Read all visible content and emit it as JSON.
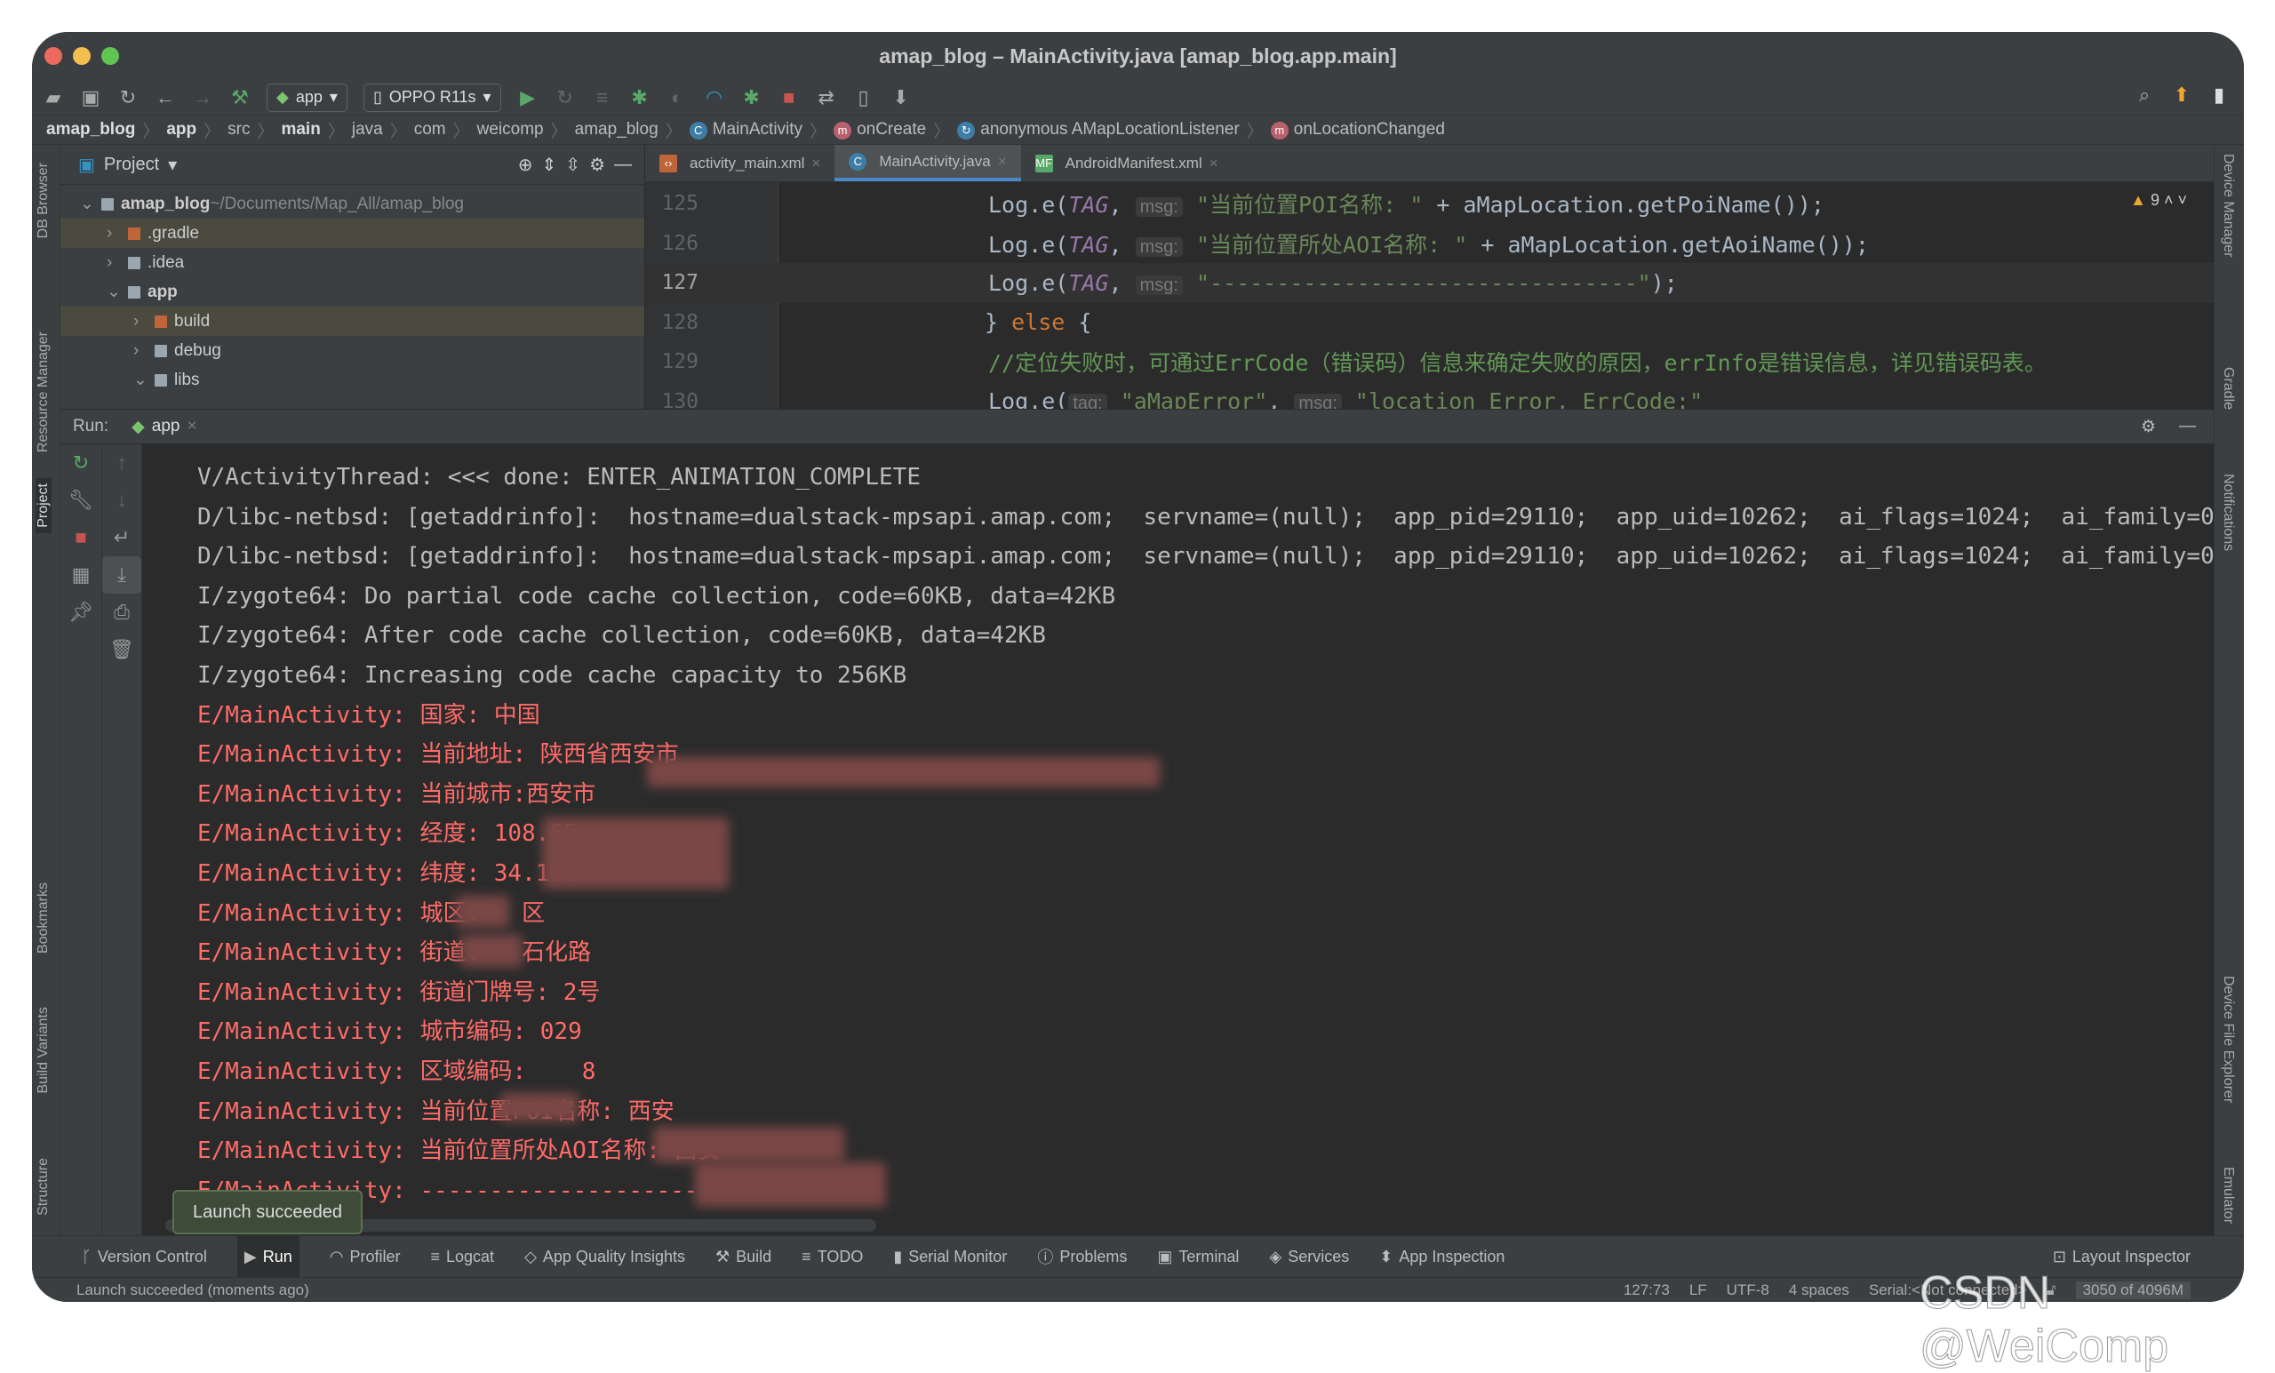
{
  "window": {
    "title": "amap_blog – MainActivity.java [amap_blog.app.main]"
  },
  "toolbar": {
    "config": "app",
    "device": "OPPO R11s"
  },
  "breadcrumb": [
    "amap_blog",
    "app",
    "src",
    "main",
    "java",
    "com",
    "weicomp",
    "amap_blog",
    "MainActivity",
    "onCreate",
    "anonymous AMapLocationListener",
    "onLocationChanged"
  ],
  "left_stripe": [
    "DB Browser",
    "Resource Manager",
    "Project",
    "Bookmarks",
    "Build Variants",
    "Structure"
  ],
  "right_stripe": [
    "Device Manager",
    "Gradle",
    "Notifications",
    "Device File Explorer",
    "Emulator"
  ],
  "project": {
    "title": "Project",
    "tree": [
      {
        "name": "amap_blog",
        "path": "~/Documents/Map_All/amap_blog",
        "depth": 0,
        "open": true,
        "bold": true
      },
      {
        "name": ".gradle",
        "depth": 1,
        "open": false,
        "excluded": true
      },
      {
        "name": ".idea",
        "depth": 1,
        "open": false
      },
      {
        "name": "app",
        "depth": 1,
        "open": true,
        "bold": true
      },
      {
        "name": "build",
        "depth": 2,
        "open": false,
        "excluded": true
      },
      {
        "name": "debug",
        "depth": 2,
        "open": false
      },
      {
        "name": "libs",
        "depth": 2,
        "open": true
      }
    ]
  },
  "editor": {
    "tabs": [
      {
        "label": "activity_main.xml",
        "active": false
      },
      {
        "label": "MainActivity.java",
        "active": true
      },
      {
        "label": "AndroidManifest.xml",
        "active": false
      }
    ],
    "warnings": "9",
    "lines": [
      {
        "n": "125",
        "segs": [
          [
            "t",
            "Log.e("
          ],
          [
            "p",
            "TAG"
          ],
          [
            "t",
            ", "
          ],
          [
            "h",
            "msg:"
          ],
          [
            "s",
            " \"当前位置POI名称: \""
          ],
          [
            "t",
            " + aMapLocation.getPoiName());"
          ]
        ]
      },
      {
        "n": "126",
        "segs": [
          [
            "t",
            "Log.e("
          ],
          [
            "p",
            "TAG"
          ],
          [
            "t",
            ", "
          ],
          [
            "h",
            "msg:"
          ],
          [
            "s",
            " \"当前位置所处AOI名称: \""
          ],
          [
            "t",
            " + aMapLocation.getAoiName());"
          ]
        ]
      },
      {
        "n": "127",
        "cur": true,
        "segs": [
          [
            "t",
            "Log.e("
          ],
          [
            "p",
            "TAG"
          ],
          [
            "t",
            ", "
          ],
          [
            "h",
            "msg:"
          ],
          [
            "s",
            " \"--------------------------------\""
          ],
          [
            "t",
            ");"
          ]
        ]
      },
      {
        "n": "128",
        "indent": -1,
        "segs": [
          [
            "t",
            "} "
          ],
          [
            "k",
            "else"
          ],
          [
            "t",
            " {"
          ]
        ]
      },
      {
        "n": "129",
        "segs": [
          [
            "c",
            "//定位失败时，可通过ErrCode（错误码）信息来确定失败的原因，errInfo是错误信息，详见错误码表。"
          ]
        ]
      },
      {
        "n": "130",
        "segs": [
          [
            "t",
            "Log.e("
          ],
          [
            "h",
            "tag:"
          ],
          [
            "s",
            " \"aMapError\""
          ],
          [
            "t",
            ", "
          ],
          [
            "h",
            "msg:"
          ],
          [
            "s",
            " \"location Error, ErrCode:\""
          ]
        ]
      }
    ]
  },
  "run": {
    "label": "Run:",
    "tab": "app",
    "log": [
      {
        "lv": "v",
        "text": "V/ActivityThread: <<< done: ENTER_ANIMATION_COMPLETE"
      },
      {
        "lv": "d",
        "text": "D/libc-netbsd: [getaddrinfo]:  hostname=dualstack-mpsapi.amap.com;  servname=(null);  app_pid=29110;  app_uid=10262;  ai_flags=1024;  ai_family=0;"
      },
      {
        "lv": "d",
        "text": "D/libc-netbsd: [getaddrinfo]:  hostname=dualstack-mpsapi.amap.com;  servname=(null);  app_pid=29110;  app_uid=10262;  ai_flags=1024;  ai_family=0;"
      },
      {
        "lv": "i",
        "text": "I/zygote64: Do partial code cache collection, code=60KB, data=42KB"
      },
      {
        "lv": "i",
        "text": "I/zygote64: After code cache collection, code=60KB, data=42KB"
      },
      {
        "lv": "i",
        "text": "I/zygote64: Increasing code cache capacity to 256KB"
      },
      {
        "lv": "e",
        "text": "E/MainActivity: 国家: 中国"
      },
      {
        "lv": "e",
        "text": "E/MainActivity: 当前地址: 陕西省西安市"
      },
      {
        "lv": "e",
        "text": "E/MainActivity: 当前城市:西安市"
      },
      {
        "lv": "e",
        "text": "E/MainActivity: 经度: 108.65"
      },
      {
        "lv": "e",
        "text": "E/MainActivity: 纬度: 34.103"
      },
      {
        "lv": "e",
        "text": "E/MainActivity: 城区:   区"
      },
      {
        "lv": "e",
        "text": "E/MainActivity: 街道:   石化路"
      },
      {
        "lv": "e",
        "text": "E/MainActivity: 街道门牌号: 2号"
      },
      {
        "lv": "e",
        "text": "E/MainActivity: 城市编码: 029"
      },
      {
        "lv": "e",
        "text": "E/MainActivity: 区域编码:    8"
      },
      {
        "lv": "e",
        "text": "E/MainActivity: 当前位置POI名称: 西安"
      },
      {
        "lv": "e",
        "text": "E/MainActivity: 当前位置所处AOI名称: 西安"
      },
      {
        "lv": "e",
        "text": "E/MainActivity: --------------------------------"
      }
    ],
    "toast": "Launch succeeded"
  },
  "tool_windows": [
    {
      "label": "Version Control",
      "icon": "branch"
    },
    {
      "label": "Run",
      "icon": "play",
      "active": true
    },
    {
      "label": "Profiler",
      "icon": "gauge"
    },
    {
      "label": "Logcat",
      "icon": "list"
    },
    {
      "label": "App Quality Insights",
      "icon": "diamond"
    },
    {
      "label": "Build",
      "icon": "hammer"
    },
    {
      "label": "TODO",
      "icon": "list"
    },
    {
      "label": "Serial Monitor",
      "icon": "plug"
    },
    {
      "label": "Problems",
      "icon": "info"
    },
    {
      "label": "Terminal",
      "icon": "terminal"
    },
    {
      "label": "Services",
      "icon": "services"
    },
    {
      "label": "App Inspection",
      "icon": "inspect"
    }
  ],
  "layout_inspector": "Layout Inspector",
  "status": {
    "message": "Launch succeeded (moments ago)",
    "position": "127:73",
    "line_sep": "LF",
    "encoding": "UTF-8",
    "indent": "4 spaces",
    "serial": "Serial:<Not connected>",
    "memory": "3050 of 4096M"
  },
  "watermark": "CSDN @WeiComp",
  "colors": {
    "error": "#ff6b68",
    "accent": "#4a88c7",
    "bg": "#2b2b2b",
    "panel": "#3c3f41"
  }
}
